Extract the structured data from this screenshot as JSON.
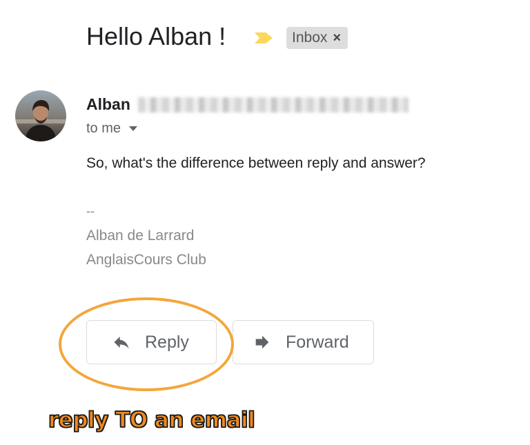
{
  "email": {
    "subject": "Hello Alban !",
    "label": "Inbox",
    "label_remove": "×",
    "sender_name": "Alban",
    "recipient": "to me",
    "body": "So, what's the difference between reply and answer?",
    "signature": {
      "dash": "--",
      "name": "Alban de Larrard",
      "org": "AnglaisCours Club"
    }
  },
  "actions": {
    "reply_label": "Reply",
    "forward_label": "Forward"
  },
  "annotation": {
    "caption": "reply TO an email",
    "color": "#f4a63a"
  },
  "icons": {
    "importance": "importance-marker-icon",
    "reply": "reply-arrow-icon",
    "forward": "forward-arrow-icon",
    "recipient_details": "chevron-down-icon"
  },
  "colors": {
    "importance": "#fbd75b",
    "chip_bg": "#dddddd",
    "button_border": "#dadce0"
  }
}
